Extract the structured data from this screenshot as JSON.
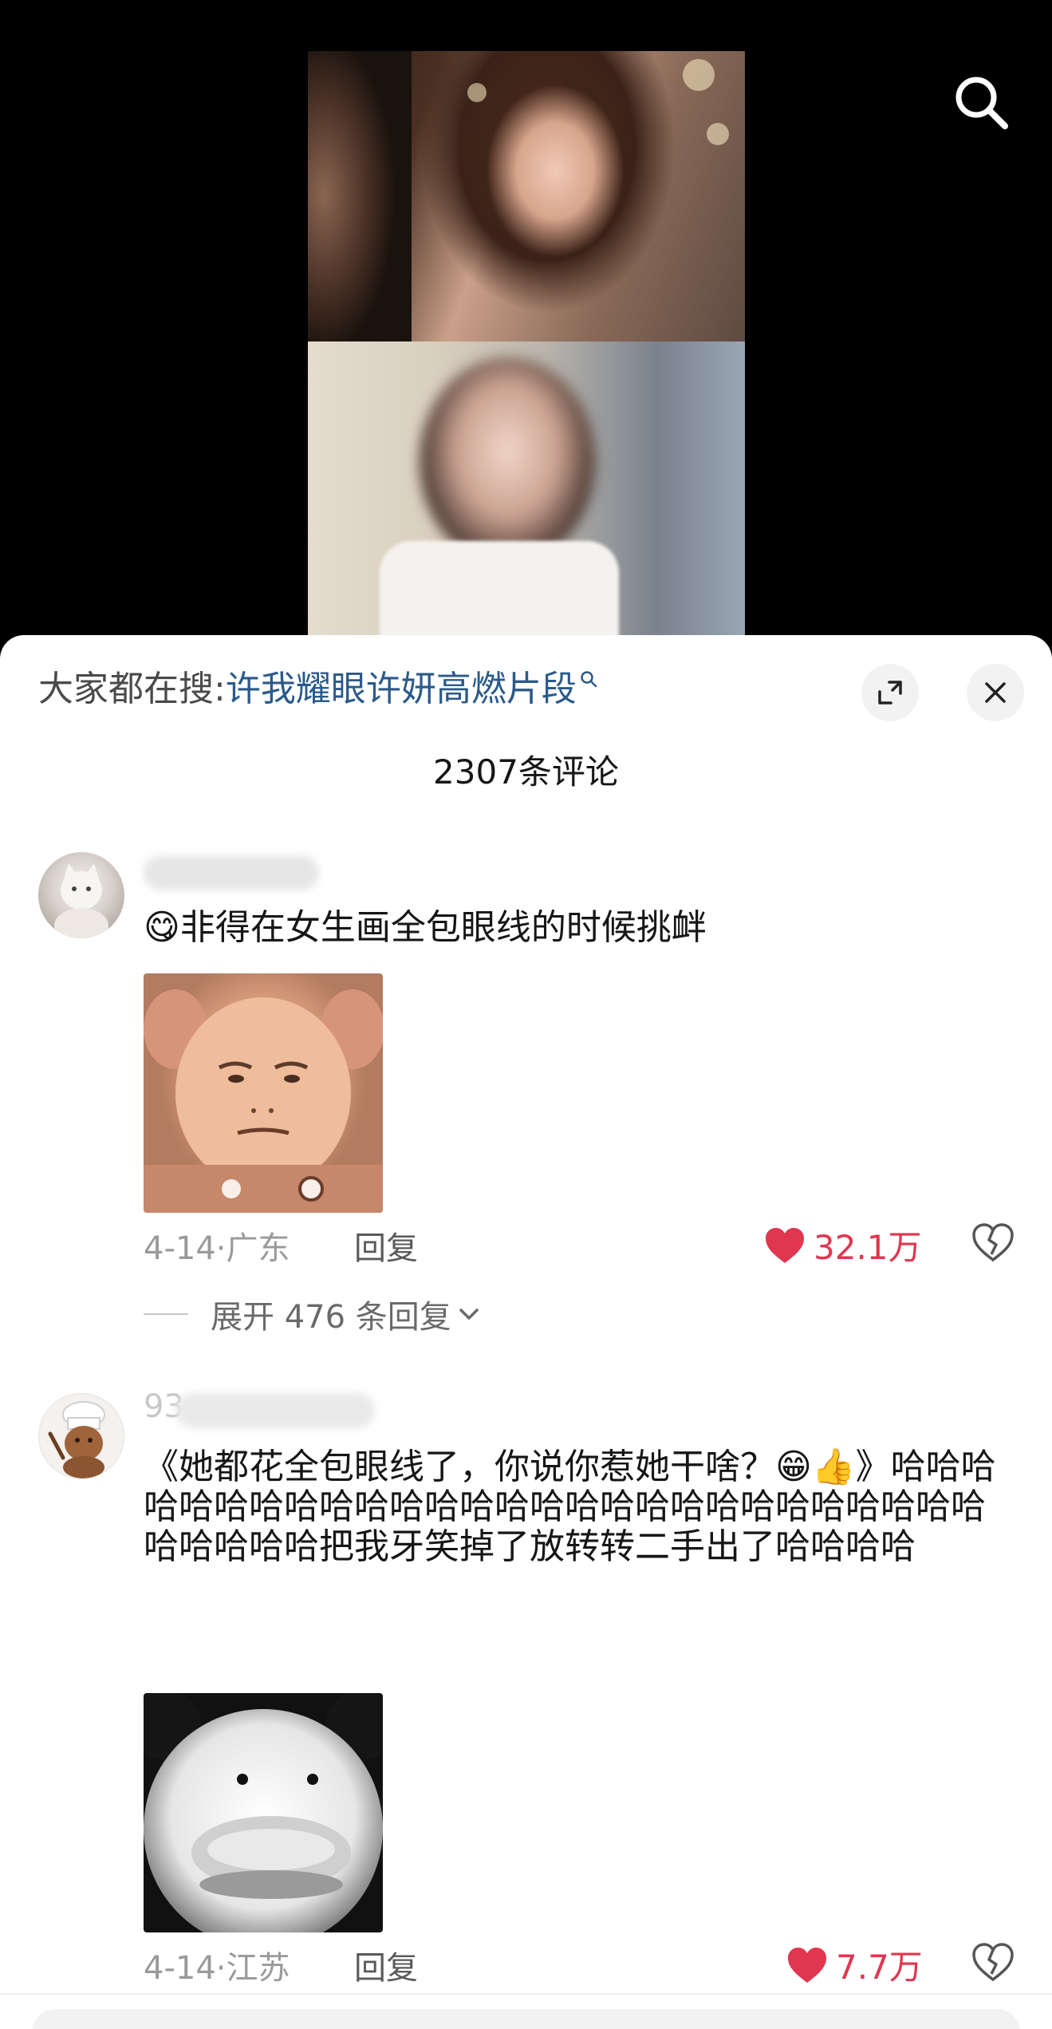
{
  "header": {
    "hot_search_prefix": "大家都在搜:",
    "hot_search_term": "许我耀眼许妍高燃片段",
    "comment_count": "2307条评论"
  },
  "icons": {
    "search": "search-icon",
    "expand": "expand-icon",
    "close": "close-icon",
    "heart": "heart-icon",
    "dislike": "broken-heart-icon",
    "chevron": "chevron-down-icon"
  },
  "colors": {
    "like": "#e0364f",
    "hot_search_term": "#2b5a8a",
    "sheet_background": "#ffffff"
  },
  "comments": [
    {
      "text": "😋非得在女生画全包眼线的时候挑衅",
      "date": "4-14",
      "location": "广东",
      "reply_label": "回复",
      "likes": "32.1万",
      "expand_replies": "展开 476 条回复"
    },
    {
      "username_visible": "93",
      "text": "《她都花全包眼线了，你说你惹她干啥？😁👍》哈哈哈哈哈哈哈哈哈哈哈哈哈哈哈哈哈哈哈哈哈哈哈哈哈哈哈哈哈哈哈哈把我牙笑掉了放转转二手出了哈哈哈哈",
      "date": "4-14",
      "location": "江苏",
      "reply_label": "回复",
      "likes": "7.7万"
    }
  ]
}
